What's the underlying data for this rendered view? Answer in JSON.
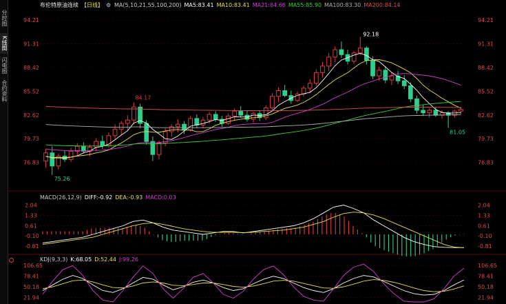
{
  "sidebar": {
    "tabs": [
      {
        "label": "分时图",
        "active": false
      },
      {
        "label": "K线图",
        "active": true
      },
      {
        "label": "闪电图",
        "active": false
      },
      {
        "label": "合约资料",
        "active": false
      }
    ]
  },
  "header": {
    "symbol": "布伦特原油连续",
    "period": "【日线】",
    "ma_params": "MA(5,10,21,55,100,200)",
    "ma5": "MA5:83.41",
    "ma10": "MA10:83.41",
    "ma21": "MA21:84.66",
    "ma55": "MA55:85.90",
    "ma100": "MA100:83.30",
    "ma200": "MA200:84.14"
  },
  "price_axis": {
    "left": [
      "94.21",
      "91.31",
      "88.42",
      "85.52",
      "82.62",
      "79.73",
      "76.83"
    ],
    "right": [
      "94.21",
      "91.31",
      "88.42",
      "85.52",
      "82.62",
      "79.73",
      "76.83"
    ]
  },
  "annotations": {
    "high": "92.18",
    "low": "75.26",
    "local_high": "84.17",
    "recent_low": "81.05"
  },
  "macd": {
    "header": {
      "params": "MACD(26,12,9)",
      "diff": "DIFF:-0.92",
      "dea": "DEA:-0.93",
      "macd": "MACD:0.03"
    },
    "axis": [
      "2.04",
      "1.33",
      "0.61",
      "-0.10",
      "-0.81"
    ]
  },
  "kdj": {
    "header": {
      "params": "KDJ(9,3,3)",
      "k": "K:68.05",
      "d": "D:52.44",
      "j": "J:99.26"
    },
    "axis": [
      "106.65",
      "78.41",
      "50.18",
      "21.94"
    ]
  },
  "colors": {
    "up": "#e03c3c",
    "down": "#2fcf8f",
    "ma5": "#ffffff",
    "ma10": "#e8e04a",
    "ma21": "#d040d0",
    "ma55": "#3ad03a",
    "ma100": "#b0b0b0",
    "ma200": "#e05050",
    "axis_text": "#e04848",
    "macd_diff": "#ffffff",
    "macd_dea": "#e8e04a",
    "kdj_k": "#ffffff",
    "kdj_d": "#e8e04a",
    "kdj_j": "#d040d0"
  },
  "chart_data": {
    "type": "candlestick",
    "price_range": [
      73.94,
      95.66
    ],
    "candles": [
      [
        77.0,
        78.5,
        76.2,
        78.0
      ],
      [
        78.0,
        78.8,
        75.3,
        76.4
      ],
      [
        76.4,
        77.9,
        76.0,
        77.6
      ],
      [
        77.6,
        78.3,
        76.9,
        77.2
      ],
      [
        77.2,
        78.6,
        76.9,
        78.2
      ],
      [
        78.2,
        79.2,
        77.6,
        78.8
      ],
      [
        78.8,
        79.3,
        78.0,
        78.2
      ],
      [
        78.2,
        79.0,
        77.6,
        78.7
      ],
      [
        78.7,
        79.8,
        78.2,
        79.4
      ],
      [
        79.4,
        80.1,
        78.5,
        78.9
      ],
      [
        78.9,
        80.5,
        78.6,
        80.1
      ],
      [
        80.1,
        81.5,
        79.6,
        80.9
      ],
      [
        80.9,
        81.9,
        80.2,
        81.6
      ],
      [
        81.6,
        82.6,
        80.8,
        82.0
      ],
      [
        82.0,
        84.17,
        81.5,
        83.6
      ],
      [
        83.6,
        84.0,
        81.0,
        81.6
      ],
      [
        81.6,
        82.0,
        79.0,
        79.4
      ],
      [
        79.4,
        80.0,
        77.0,
        77.8
      ],
      [
        77.8,
        79.5,
        77.2,
        79.2
      ],
      [
        79.2,
        81.0,
        78.8,
        80.6
      ],
      [
        80.6,
        81.5,
        80.0,
        81.2
      ],
      [
        81.2,
        82.1,
        80.5,
        81.5
      ],
      [
        81.5,
        81.9,
        80.3,
        80.8
      ],
      [
        80.8,
        82.5,
        80.6,
        82.2
      ],
      [
        82.2,
        82.7,
        81.0,
        81.4
      ],
      [
        81.4,
        82.4,
        81.0,
        82.0
      ],
      [
        82.0,
        83.0,
        81.6,
        82.7
      ],
      [
        82.7,
        83.1,
        81.8,
        82.1
      ],
      [
        82.1,
        82.5,
        81.2,
        81.6
      ],
      [
        81.6,
        82.8,
        81.4,
        82.5
      ],
      [
        82.5,
        83.4,
        81.9,
        83.1
      ],
      [
        83.1,
        83.7,
        82.3,
        82.6
      ],
      [
        82.6,
        83.2,
        81.8,
        82.1
      ],
      [
        82.1,
        83.0,
        81.7,
        82.8
      ],
      [
        82.8,
        83.2,
        81.9,
        82.3
      ],
      [
        82.3,
        83.8,
        82.0,
        83.5
      ],
      [
        83.5,
        85.3,
        83.2,
        84.9
      ],
      [
        84.9,
        86.0,
        84.2,
        85.6
      ],
      [
        85.6,
        86.3,
        84.8,
        85.0
      ],
      [
        85.0,
        85.6,
        84.0,
        84.4
      ],
      [
        84.4,
        85.5,
        84.2,
        85.2
      ],
      [
        85.2,
        86.2,
        84.9,
        85.9
      ],
      [
        85.9,
        87.0,
        85.3,
        86.5
      ],
      [
        86.5,
        88.2,
        86.2,
        87.8
      ],
      [
        87.8,
        89.1,
        87.2,
        88.6
      ],
      [
        88.6,
        90.2,
        88.0,
        89.7
      ],
      [
        89.7,
        91.0,
        89.1,
        90.6
      ],
      [
        90.6,
        91.6,
        89.6,
        90.0
      ],
      [
        90.0,
        90.6,
        88.8,
        89.2
      ],
      [
        89.2,
        90.4,
        88.9,
        90.2
      ],
      [
        90.2,
        92.18,
        89.9,
        90.8
      ],
      [
        90.8,
        91.0,
        88.8,
        89.3
      ],
      [
        89.3,
        89.8,
        87.0,
        87.4
      ],
      [
        87.4,
        88.5,
        86.8,
        88.1
      ],
      [
        88.1,
        88.6,
        86.5,
        86.9
      ],
      [
        86.9,
        87.8,
        86.3,
        87.4
      ],
      [
        87.4,
        88.0,
        86.4,
        86.8
      ],
      [
        86.8,
        87.5,
        85.8,
        86.2
      ],
      [
        86.2,
        86.6,
        84.2,
        84.6
      ],
      [
        84.6,
        85.0,
        82.8,
        83.2
      ],
      [
        83.2,
        83.9,
        82.5,
        82.9
      ],
      [
        82.9,
        83.5,
        82.3,
        83.2
      ],
      [
        83.2,
        83.6,
        82.4,
        82.6
      ],
      [
        82.6,
        83.2,
        82.2,
        82.9
      ],
      [
        82.9,
        83.1,
        81.05,
        82.6
      ],
      [
        82.6,
        83.3,
        82.3,
        83.1
      ],
      [
        83.1,
        83.6,
        82.7,
        83.3
      ]
    ],
    "macd": {
      "diff": [
        -0.6,
        -0.5,
        -0.4,
        -0.3,
        -0.2,
        0.0,
        0.2,
        0.4,
        0.6,
        0.9,
        1.0,
        0.8,
        0.5,
        0.3,
        0.2,
        0.1,
        0.0,
        0.1,
        0.2,
        0.2,
        0.1,
        0.2,
        0.3,
        0.4,
        0.5,
        0.6,
        0.8,
        1.1,
        1.5,
        1.9,
        2.04,
        1.8,
        1.5,
        1.0,
        0.6,
        0.2,
        -0.2,
        -0.5,
        -0.7,
        -0.85,
        -0.9,
        -0.92,
        -0.92
      ],
      "dea": [
        -0.7,
        -0.6,
        -0.5,
        -0.4,
        -0.3,
        -0.2,
        0.0,
        0.2,
        0.4,
        0.6,
        0.75,
        0.8,
        0.7,
        0.55,
        0.4,
        0.3,
        0.2,
        0.15,
        0.15,
        0.15,
        0.12,
        0.15,
        0.2,
        0.25,
        0.3,
        0.4,
        0.5,
        0.7,
        0.9,
        1.2,
        1.45,
        1.55,
        1.5,
        1.35,
        1.1,
        0.8,
        0.5,
        0.2,
        -0.1,
        -0.4,
        -0.7,
        -0.88,
        -0.93
      ]
    },
    "kdj": {
      "k": [
        40,
        55,
        70,
        80,
        72,
        55,
        40,
        35,
        45,
        60,
        75,
        70,
        55,
        42,
        50,
        62,
        68,
        60,
        48,
        40,
        45,
        58,
        70,
        78,
        72,
        60,
        48,
        40,
        35,
        45,
        60,
        72,
        80,
        76,
        64,
        52,
        40,
        32,
        28,
        30,
        40,
        55,
        68.05
      ],
      "d": [
        45,
        50,
        58,
        66,
        68,
        63,
        55,
        48,
        47,
        52,
        60,
        63,
        60,
        54,
        53,
        56,
        60,
        60,
        56,
        51,
        49,
        52,
        58,
        65,
        67,
        65,
        59,
        53,
        47,
        46,
        50,
        57,
        65,
        69,
        67,
        62,
        55,
        47,
        40,
        37,
        38,
        44,
        52.44
      ],
      "j": [
        30,
        65,
        95,
        106,
        80,
        40,
        15,
        10,
        40,
        75,
        105,
        85,
        45,
        20,
        45,
        75,
        85,
        60,
        30,
        20,
        38,
        70,
        95,
        105,
        82,
        50,
        25,
        15,
        12,
        45,
        80,
        102,
        110,
        90,
        58,
        32,
        12,
        5,
        8,
        18,
        45,
        78,
        99.26
      ]
    }
  }
}
